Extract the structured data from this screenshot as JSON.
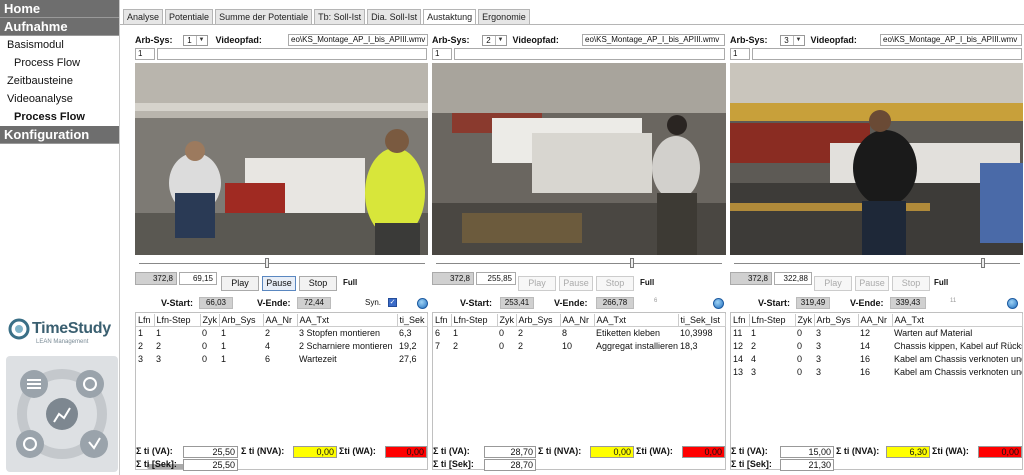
{
  "nav": {
    "home": "Home",
    "aufnahme": "Aufnahme",
    "items": [
      "Basismodul",
      "Process Flow",
      "Zeitbausteine",
      "Videoanalyse",
      "Process Flow"
    ],
    "konfiguration": "Konfiguration"
  },
  "logo": {
    "name": "TimeStudy",
    "tagline": "LEAN Management"
  },
  "tabs": [
    "Analyse",
    "Potentiale",
    "Summe der Potentiale",
    "Tb: Soll-Ist",
    "Dia. Soll-Ist",
    "Austaktung",
    "Ergonomie"
  ],
  "active_tab": "Austaktung",
  "labels": {
    "arb_sys": "Arb-Sys:",
    "videopfad": "Videopfad:",
    "play": "Play",
    "pause": "Pause",
    "stop": "Stop",
    "full": "Full",
    "v_start": "V-Start:",
    "v_ende": "V-Ende:",
    "syn": "Syn.",
    "sum_va": "Σ ti (VA):",
    "sum_nva": "Σ ti (NVA):",
    "sum_wa": "Σti (WA):",
    "sum_sek": "Σ ti [Sek]:",
    "check": "✓"
  },
  "columns": [
    "Lfn",
    "Lfn-Step",
    "Zyk",
    "Arb_Sys",
    "AA_Nr",
    "AA_Txt",
    "ti_Sek",
    "ti_Sek_Ist"
  ],
  "colors": {
    "yellow": "#ffff00",
    "red": "#ff0000",
    "nav_bg": "#6e6e6e"
  },
  "panels": [
    {
      "sys": "1",
      "path": "eo\\KS_Montage_AP_I_bis_APIII.wmv",
      "index": "1",
      "time_a": "372,8",
      "time_b": "69,15",
      "v_start": "66,03",
      "v_ende": "72,44",
      "rows": [
        [
          "1",
          "1",
          "0",
          "1",
          "2",
          "3 Stopfen montieren",
          "6,3"
        ],
        [
          "2",
          "2",
          "0",
          "1",
          "4",
          "2 Scharniere montieren",
          "19,2"
        ],
        [
          "3",
          "3",
          "0",
          "1",
          "6",
          "Wartezeit",
          "27,6"
        ]
      ],
      "sum_va": "25,50",
      "sum_nva": "0,00",
      "sum_wa": "0,00",
      "sum_sek": "25,50"
    },
    {
      "sys": "2",
      "path": "eo\\KS_Montage_AP_I_bis_APIII.wmv",
      "index": "1",
      "time_a": "372,8",
      "time_b": "255,85",
      "v_start": "253,41",
      "v_ende": "266,78",
      "extra_small": "6",
      "rows": [
        [
          "6",
          "1",
          "0",
          "2",
          "8",
          "Etiketten kleben",
          "10,3998"
        ],
        [
          "7",
          "2",
          "0",
          "2",
          "10",
          "Aggregat installieren",
          "18,3"
        ]
      ],
      "sum_va": "28,70",
      "sum_nva": "0,00",
      "sum_wa": "0,00",
      "sum_sek": "28,70"
    },
    {
      "sys": "3",
      "path": "eo\\KS_Montage_AP_I_bis_APIII.wmv",
      "index": "1",
      "time_a": "372,8",
      "time_b": "322,88",
      "v_start": "319,49",
      "v_ende": "339,43",
      "extra_small": "11",
      "rows": [
        [
          "11",
          "1",
          "0",
          "3",
          "12",
          "Warten auf Material"
        ],
        [
          "12",
          "2",
          "0",
          "3",
          "14",
          "Chassis kippen, Kabel auf Rücks"
        ],
        [
          "14",
          "4",
          "0",
          "3",
          "16",
          "Kabel am Chassis verknoten und"
        ],
        [
          "13",
          "3",
          "0",
          "3",
          "16",
          "Kabel am Chassis verknoten und"
        ]
      ],
      "sum_va": "15,00",
      "sum_nva": "6,30",
      "sum_wa": "0,00",
      "sum_sek": "21,30"
    }
  ]
}
